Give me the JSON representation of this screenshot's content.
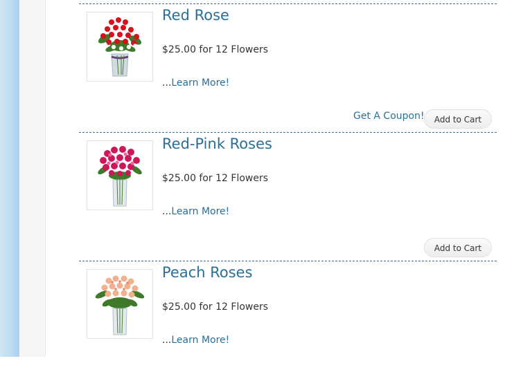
{
  "products": [
    {
      "title": "Red Rose",
      "price": "$25.00 for 12 Flowers",
      "learn_prefix": "...",
      "learn_link": "Learn More!",
      "coupon": "Get A Coupon!",
      "cart": "Add to Cart",
      "image": "red-rose-bouquet"
    },
    {
      "title": "Red-Pink Roses",
      "price": "$25.00 for 12 Flowers",
      "learn_prefix": "...",
      "learn_link": "Learn More!",
      "cart": "Add to Cart",
      "image": "red-pink-rose-bouquet"
    },
    {
      "title": "Peach Roses",
      "price": "$25.00 for 12 Flowers",
      "learn_prefix": "...",
      "learn_link": "Learn More!",
      "image": "peach-rose-bouquet"
    }
  ],
  "colors": {
    "link": "#2a6f97",
    "text": "#333333",
    "divider": "#4a6a80"
  }
}
